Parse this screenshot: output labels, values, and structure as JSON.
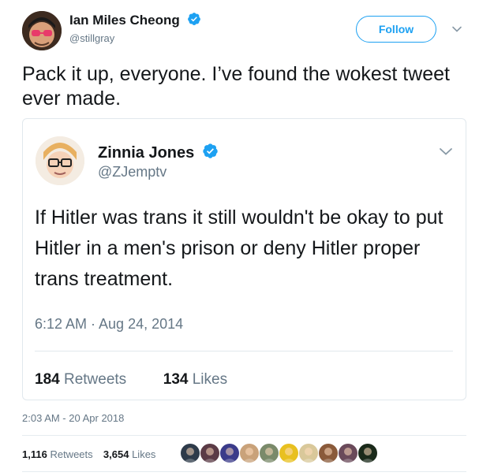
{
  "tweet": {
    "author_name": "Ian Miles Cheong",
    "author_handle": "@stillgray",
    "follow_label": "Follow",
    "text": "Pack it up, everyone. I’ve found the wokest tweet ever made.",
    "timestamp": "2:03 AM - 20 Apr 2018",
    "retweet_count": "1,116",
    "retweet_label": "Retweets",
    "like_count": "3,654",
    "like_label": "Likes"
  },
  "quoted": {
    "author_name": "Zinnia Jones",
    "author_handle": "@ZJemptv",
    "text": "If Hitler was trans it still wouldn't be okay to put Hitler in a men's prison or deny Hitler proper trans treatment.",
    "timestamp": "6:12 AM · Aug 24, 2014",
    "retweet_count": "184",
    "retweet_label": "Retweets",
    "like_count": "134",
    "like_label": "Likes"
  },
  "likers": [
    {
      "name": "liker-avatar",
      "color": "#2e3b4a"
    },
    {
      "name": "liker-avatar",
      "color": "#5b3b46"
    },
    {
      "name": "liker-avatar",
      "color": "#3b3b8a"
    },
    {
      "name": "liker-avatar",
      "color": "#c9a27a"
    },
    {
      "name": "liker-avatar",
      "color": "#7a8a6a"
    },
    {
      "name": "liker-avatar",
      "color": "#e8c020"
    },
    {
      "name": "liker-avatar",
      "color": "#d9c89a"
    },
    {
      "name": "liker-avatar",
      "color": "#8a5a3a"
    },
    {
      "name": "liker-avatar",
      "color": "#6a4a5a"
    },
    {
      "name": "liker-avatar",
      "color": "#1a2a1a"
    }
  ],
  "colors": {
    "accent": "#1da1f2",
    "verified": "#1da1f2",
    "muted": "#657786",
    "text": "#14171a"
  }
}
